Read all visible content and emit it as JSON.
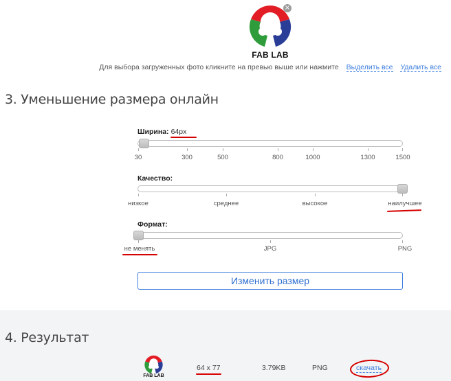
{
  "preview": {
    "logo_text": "FAB LAB",
    "remove_symbol": "×"
  },
  "hint": {
    "text": "Для выбора загруженных фото кликните на превью выше или нажмите",
    "select_all": "Выделить все",
    "delete_all": "Удалить все"
  },
  "section3": {
    "title": "3. Уменьшение размера онлайн",
    "width": {
      "label": "Ширина:",
      "value": "64px",
      "value_fraction": 0.02,
      "ticks": [
        "30",
        "300",
        "500",
        "800",
        "1000",
        "1300",
        "1500"
      ]
    },
    "quality": {
      "label": "Качество:",
      "value_fraction": 1.0,
      "ticks": [
        "низкое",
        "среднее",
        "высокое",
        "наилучшее"
      ]
    },
    "format": {
      "label": "Формат:",
      "value_fraction": 0.0,
      "ticks": [
        "не менять",
        "JPG",
        "PNG"
      ]
    },
    "resize_button": "Изменить размер"
  },
  "section4": {
    "title": "4. Результат",
    "logo_text": "FAB LAB",
    "dimensions": "64 x 77",
    "size": "3.79KB",
    "format": "PNG",
    "download": "скачать"
  },
  "colors": {
    "accent": "#3b7ddd",
    "annotation": "#d50000",
    "logo_red": "#e21d26",
    "logo_green": "#2f9c3b",
    "logo_blue": "#2b3e97"
  }
}
